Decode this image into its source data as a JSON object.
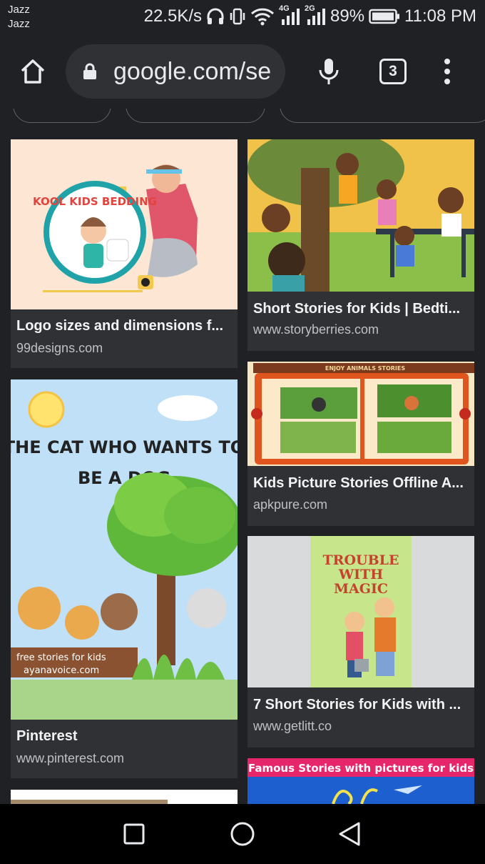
{
  "status_bar": {
    "carrier_1": "Jazz",
    "carrier_2": "Jazz",
    "net_speed": "22.5K/s",
    "network_1": "4G",
    "network_2": "2G",
    "battery": "89%",
    "time": "11:08 PM"
  },
  "toolbar": {
    "url": "google.com/se",
    "tab_count": "3"
  },
  "results": {
    "left": [
      {
        "title": "Logo sizes and dimensions f...",
        "source": "99designs.com",
        "image_text": "KOOL KIDS BEDDING"
      },
      {
        "title": "Pinterest",
        "source": "www.pinterest.com",
        "image_text_1": "THE CAT WHO WANTS TO",
        "image_text_2": "BE A DOG",
        "image_caption_1": "free stories for kids",
        "image_caption_2": "ayanavoice.com"
      },
      {
        "title": "",
        "source": ""
      }
    ],
    "right": [
      {
        "title": "Short Stories for Kids | Bedti...",
        "source": "www.storyberries.com"
      },
      {
        "title": "Kids Picture Stories Offline A...",
        "source": "apkpure.com",
        "image_text": "ENJOY ANIMALS STORIES"
      },
      {
        "title": "7 Short Stories for Kids with ...",
        "source": "www.getlitt.co",
        "image_text_1": "TROUBLE",
        "image_text_2": "WITH",
        "image_text_3": "MAGIC"
      },
      {
        "title": "",
        "source": "",
        "image_text": "Famous Stories with pictures for kids"
      }
    ]
  },
  "icons": [
    "headphones-icon",
    "vibrate-icon",
    "wifi-icon",
    "signal-icon",
    "battery-icon",
    "home-icon",
    "lock-icon",
    "mic-icon",
    "tab-switcher-icon",
    "overflow-menu-icon",
    "recents-icon",
    "home-circle-icon",
    "back-icon"
  ],
  "colors": {
    "background": "#202124",
    "card": "#303134",
    "text": "#f1f3f4",
    "subtext": "#bdc1c6"
  }
}
